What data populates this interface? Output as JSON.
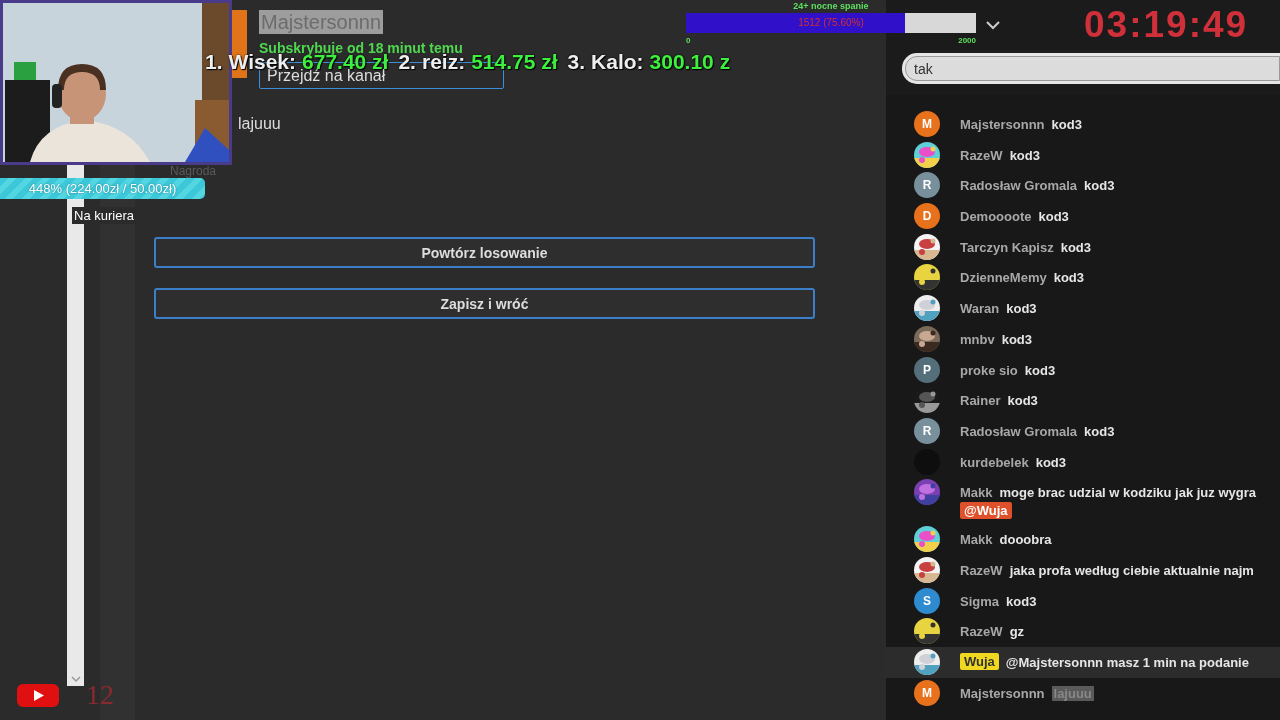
{
  "webcam": {
    "kind": "picture"
  },
  "profile": {
    "username": "Majstersonnn",
    "status": "Subskrybuje od 18 minut temu",
    "channel_button": "Przejdź na kanał"
  },
  "leaderboard": [
    {
      "rank": "1.",
      "name": "Wisek:",
      "amount": "677.40 zł"
    },
    {
      "rank": "2.",
      "name": "reiz:",
      "amount": "514.75 zł"
    },
    {
      "rank": "3.",
      "name": "Kalo:",
      "amount": "300.10 z"
    }
  ],
  "reply": "lajuuu",
  "reward_label": "Nagroda",
  "donation_goal": {
    "title": "Na kuriera",
    "label": "448% (224.00zł / 50.00zł)",
    "level": 1
  },
  "buttons": [
    "Powtórz losowanie",
    "Zapisz i wróć"
  ],
  "youtube_count": "12",
  "sub_goal": {
    "title": "24+ nocne spanie",
    "reading": "1512 (75.60%)",
    "level": 0.756,
    "min": "0",
    "max": "2000"
  },
  "timer": "03:19:49",
  "chat": {
    "input_value": "tak",
    "messages": [
      {
        "author": "Majstersonnn",
        "text": "kod3",
        "avatar": {
          "kind": "letter",
          "letter": "M",
          "color": "#e8711c"
        },
        "highlighted": false,
        "marked": false
      },
      {
        "author": "RazeW",
        "text": "kod3",
        "avatar": {
          "kind": "picture"
        },
        "highlighted": false,
        "marked": false
      },
      {
        "author": "Radosław Gromala",
        "text": "kod3",
        "avatar": {
          "kind": "letter",
          "letter": "R",
          "color": "#78909c"
        },
        "highlighted": false,
        "marked": false
      },
      {
        "author": "Demoooote",
        "text": "kod3",
        "avatar": {
          "kind": "letter",
          "letter": "D",
          "color": "#e8711c"
        },
        "highlighted": false,
        "marked": false
      },
      {
        "author": "Tarczyn Kapisz",
        "text": "kod3",
        "avatar": {
          "kind": "picture"
        },
        "highlighted": false,
        "marked": false
      },
      {
        "author": "DzienneMemy",
        "text": "kod3",
        "avatar": {
          "kind": "picture"
        },
        "highlighted": false,
        "marked": false
      },
      {
        "author": "Waran",
        "text": "kod3",
        "avatar": {
          "kind": "picture"
        },
        "highlighted": false,
        "marked": false
      },
      {
        "author": "mnbv",
        "text": "kod3",
        "avatar": {
          "kind": "picture"
        },
        "highlighted": false,
        "marked": false
      },
      {
        "author": "proke sio",
        "text": "kod3",
        "avatar": {
          "kind": "letter",
          "letter": "P",
          "color": "#546e7a"
        },
        "highlighted": false,
        "marked": false
      },
      {
        "author": "Rainer",
        "text": "kod3",
        "avatar": {
          "kind": "picture"
        },
        "highlighted": false,
        "marked": false
      },
      {
        "author": "Radosław Gromala",
        "text": "kod3",
        "avatar": {
          "kind": "letter",
          "letter": "R",
          "color": "#78909c"
        },
        "highlighted": false,
        "marked": false
      },
      {
        "author": "kurdebelek",
        "text": "kod3",
        "avatar": {
          "kind": "blank",
          "color": "#0e0e0e"
        },
        "highlighted": false,
        "marked": false
      },
      {
        "author": "Makk",
        "text": "moge brac udzial w kodziku jak juz wygra",
        "mention": "@Wuja",
        "avatar": {
          "kind": "picture"
        },
        "highlighted": false,
        "marked": false
      },
      {
        "author": "Makk",
        "text": "dooobra",
        "avatar": {
          "kind": "picture"
        },
        "highlighted": false,
        "marked": false
      },
      {
        "author": "RazeW",
        "text": "jaka profa według ciebie aktualnie najm",
        "avatar": {
          "kind": "picture"
        },
        "highlighted": false,
        "marked": false
      },
      {
        "author": "Sigma",
        "text": "kod3",
        "avatar": {
          "kind": "letter",
          "letter": "S",
          "color": "#2e8bd0"
        },
        "highlighted": false,
        "marked": false
      },
      {
        "author": "RazeW",
        "text": "gz",
        "avatar": {
          "kind": "picture"
        },
        "highlighted": false,
        "marked": false
      },
      {
        "author": "Wuja",
        "text": "@Majstersonnn masz 1 min na podanie",
        "avatar": {
          "kind": "picture"
        },
        "highlighted": true,
        "marked": false
      },
      {
        "author": "Majstersonnn",
        "text": "lajuuu",
        "avatar": {
          "kind": "letter",
          "letter": "M",
          "color": "#e8711c"
        },
        "highlighted": false,
        "marked": true
      }
    ]
  }
}
